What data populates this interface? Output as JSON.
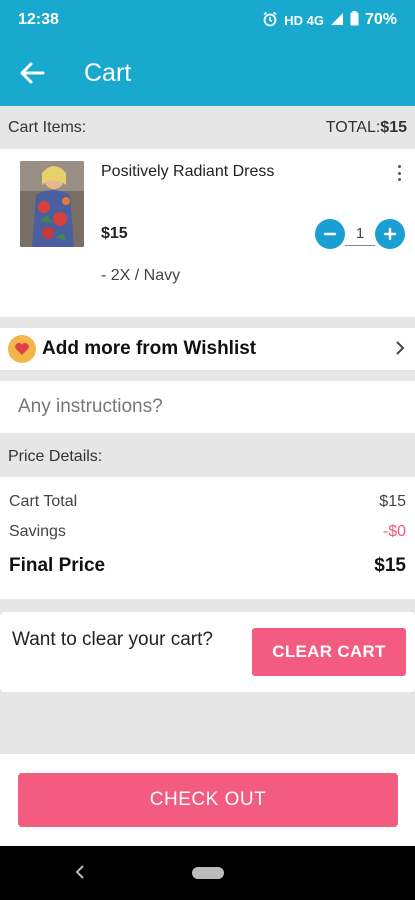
{
  "status_bar": {
    "time": "12:38",
    "network": "HD 4G",
    "battery": "70%",
    "icons": [
      "alarm-icon",
      "signal-icon",
      "battery-icon"
    ]
  },
  "app_bar": {
    "title": "Cart",
    "back_icon": "arrow-left-icon"
  },
  "cart_header": {
    "label": "Cart Items:",
    "total_label": "TOTAL:",
    "total_value": "$15"
  },
  "cart_items": [
    {
      "name": "Positively Radiant Dress",
      "price": "$15",
      "variant": "- 2X / Navy",
      "quantity": "1"
    }
  ],
  "wishlist": {
    "label": "Add more from Wishlist",
    "icon": "heart-icon"
  },
  "instructions": {
    "placeholder": "Any instructions?"
  },
  "price_details": {
    "label": "Price Details:",
    "cart_total_label": "Cart Total",
    "cart_total_value": "$15",
    "savings_label": "Savings",
    "savings_value": "-$0",
    "final_label": "Final Price",
    "final_value": "$15"
  },
  "clear_cart": {
    "prompt": "Want to clear your cart?",
    "button": "CLEAR CART"
  },
  "checkout": {
    "button": "CHECK OUT"
  },
  "colors": {
    "primary": "#19a9cf",
    "accent": "#f45b80",
    "stepper": "#1a9ed3",
    "savings": "#f2597f"
  }
}
